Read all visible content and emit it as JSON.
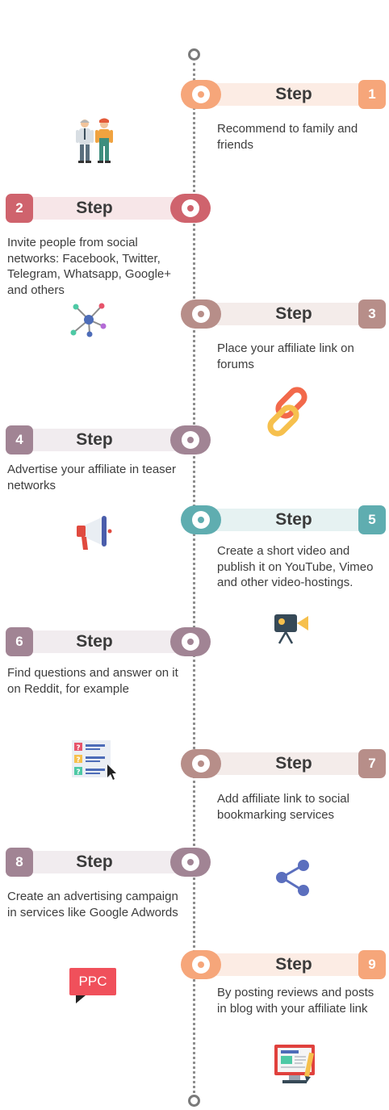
{
  "steps": [
    {
      "label": "Step",
      "number": "1",
      "text": "Recommend to family and friends",
      "color": "#f6a67a",
      "band": "#fcece4",
      "icon": "people-icon"
    },
    {
      "label": "Step",
      "number": "2",
      "text": "Invite people from social networks: Facebook, Twitter, Telegram, Whatsapp, Google+ and others",
      "color": "#cf636d",
      "band": "#f7e6e8",
      "icon": "network-icon"
    },
    {
      "label": "Step",
      "number": "3",
      "text": "Place your affiliate link on forums",
      "color": "#b78e89",
      "band": "#f4ecea",
      "icon": "chain-link-icon"
    },
    {
      "label": "Step",
      "number": "4",
      "text": "Advertise your affiliate in teaser networks",
      "color": "#a18494",
      "band": "#f1ecef",
      "icon": "megaphone-icon"
    },
    {
      "label": "Step",
      "number": "5",
      "text": "Create a short video and publish it on YouTube, Vimeo and other video-hostings.",
      "color": "#5fadb0",
      "band": "#e6f2f2",
      "icon": "video-camera-icon"
    },
    {
      "label": "Step",
      "number": "6",
      "text": "Find questions and answer on it on Reddit, for example",
      "color": "#a18494",
      "band": "#f1ecef",
      "icon": "questions-icon"
    },
    {
      "label": "Step",
      "number": "7",
      "text": "Add affiliate link to social bookmarking services",
      "color": "#b78e89",
      "band": "#f4ecea",
      "icon": "share-icon"
    },
    {
      "label": "Step",
      "number": "8",
      "text": "Create an advertising campaign in services like Google Adwords",
      "color": "#a18494",
      "band": "#f1ecef",
      "icon": "ppc-icon"
    },
    {
      "label": "Step",
      "number": "9",
      "text": "By posting reviews and posts in blog with your affiliate link",
      "color": "#f6a67a",
      "band": "#fcece4",
      "icon": "blog-icon"
    }
  ],
  "ppc_text": "PPC"
}
